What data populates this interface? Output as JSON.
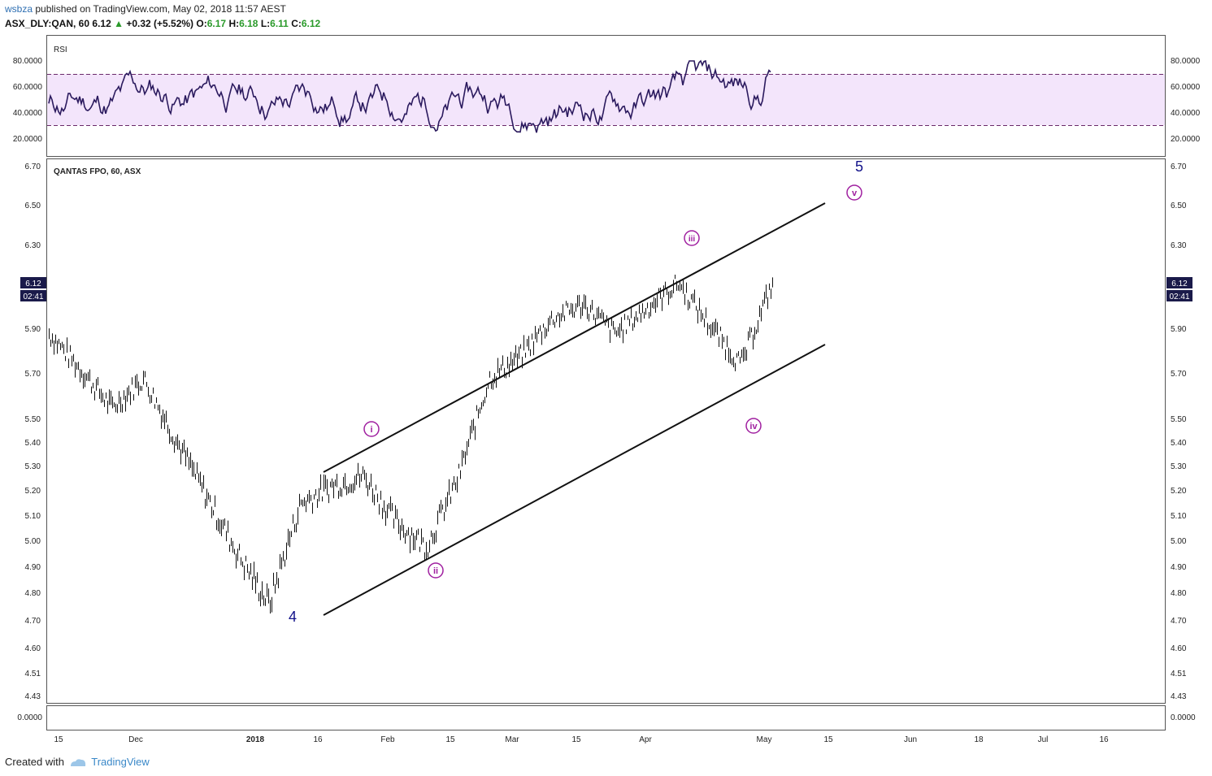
{
  "header": {
    "user": "wsbza",
    "published": "published on TradingView.com, May 02, 2018 11:57 AEST",
    "symbol": "ASX_DLY:QAN, 60",
    "price": "6.12",
    "arrow": "▲",
    "change": "+0.32 (+5.52%)",
    "o_label": "O:",
    "o_val": "6.17",
    "h_label": "H:",
    "h_val": "6.18",
    "l_label": "L:",
    "l_val": "6.11",
    "c_label": "C:",
    "c_val": "6.12"
  },
  "rsi_pane": {
    "title": "RSI",
    "ticks": [
      "80.0000",
      "60.0000",
      "40.0000",
      "20.0000"
    ]
  },
  "main_pane": {
    "title": "QANTAS FPO, 60, ASX",
    "ticks": [
      "6.70",
      "6.50",
      "6.30",
      "5.90",
      "5.70",
      "5.50",
      "5.40",
      "5.30",
      "5.20",
      "5.10",
      "5.00",
      "4.90",
      "4.80",
      "4.70",
      "4.60",
      "4.51",
      "4.43"
    ],
    "price_tag": "6.12",
    "time_tag": "02:41"
  },
  "bottom_pane": {
    "tick": "0.0000"
  },
  "x_axis": [
    "15",
    "Dec",
    "2018",
    "16",
    "Feb",
    "15",
    "Mar",
    "15",
    "Apr",
    "May",
    "15",
    "Jun",
    "18",
    "Jul",
    "16"
  ],
  "wave_labels": {
    "w4": "4",
    "w5": "5",
    "wi": "i",
    "wii": "ii",
    "wiii": "iii",
    "wiv": "iv",
    "wv": "v"
  },
  "footer": {
    "created": "Created with",
    "brand": "TradingView"
  },
  "colors": {
    "rsi_line": "#2b1a5e",
    "rsi_band": "#f3e5fb",
    "wave_major": "#12128a",
    "wave_minor": "#a020a0",
    "tag_bg": "#1a1a4a"
  },
  "chart_data": {
    "type": "line",
    "series": [
      {
        "name": "QANTAS FPO, 60, ASX",
        "x": [
          "Nov 13",
          "Nov 20",
          "Nov 27",
          "Dec 4",
          "Dec 11",
          "Dec 18",
          "Jan 2",
          "Jan 9",
          "Jan 16",
          "Jan 23",
          "Jan 30",
          "Feb 6",
          "Feb 13",
          "Feb 20",
          "Feb 27",
          "Mar 5",
          "Mar 12",
          "Mar 19",
          "Mar 26",
          "Apr 3",
          "Apr 10",
          "Apr 17",
          "Apr 24",
          "May 2"
        ],
        "values": [
          5.88,
          5.72,
          5.55,
          5.68,
          5.42,
          5.18,
          4.95,
          4.76,
          5.15,
          5.22,
          5.26,
          5.08,
          4.98,
          5.25,
          5.68,
          5.78,
          5.95,
          6.02,
          5.88,
          6.0,
          6.12,
          5.92,
          5.74,
          6.12
        ]
      }
    ],
    "ylim": [
      4.43,
      6.7
    ],
    "rsi_ylim": [
      20,
      80
    ]
  }
}
